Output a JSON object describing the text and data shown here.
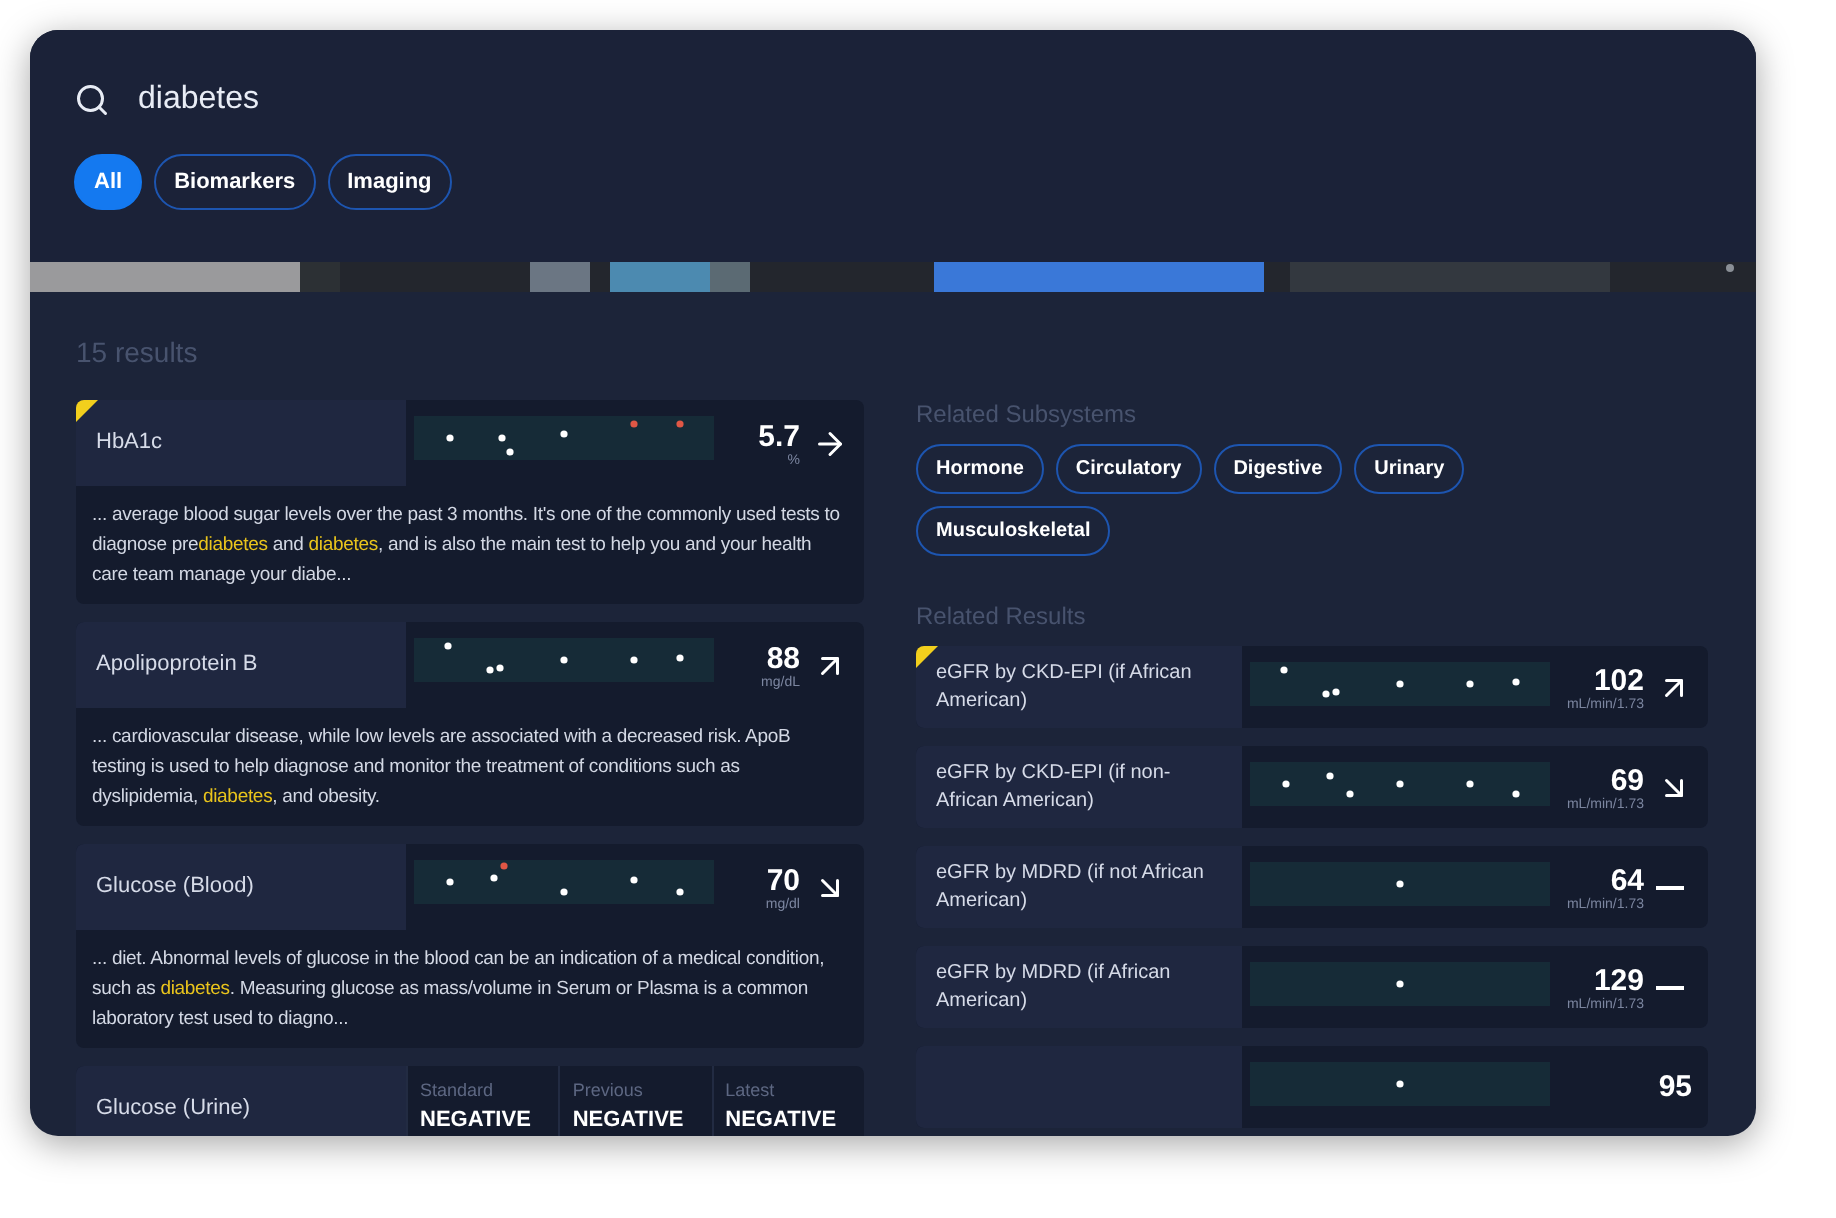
{
  "search": {
    "value": "diabetes"
  },
  "filters": [
    {
      "label": "All",
      "selected": true
    },
    {
      "label": "Biomarkers",
      "selected": false
    },
    {
      "label": "Imaging",
      "selected": false
    }
  ],
  "results_count": "15 results",
  "results": [
    {
      "kind": "numeric",
      "name": "HbA1c",
      "flagged": true,
      "value": "5.7",
      "unit": "%",
      "trend": {
        "kind": "right"
      },
      "snippet": "... average blood sugar levels over the past 3 months. It's one of the commonly used tests to diagnose pre**diabetes** and **diabetes**, and is also the main test to help you and your health care team manage your diabe..."
    },
    {
      "kind": "numeric",
      "name": "Apolipoprotein B",
      "flagged": false,
      "value": "88",
      "unit": "mg/dL",
      "trend": {
        "kind": "up"
      },
      "snippet": "... cardiovascular disease, while low levels are associated with a decreased risk. ApoB testing is used to help diagnose and monitor the treatment of conditions such as dyslipidemia, **diabetes**, and obesity."
    },
    {
      "kind": "numeric",
      "name": "Glucose (Blood)",
      "flagged": false,
      "value": "70",
      "unit": "mg/dl",
      "trend": {
        "kind": "down"
      },
      "snippet": "... diet. Abnormal levels of glucose in the blood can be an indication of a medical condition, such as **diabetes**. Measuring glucose as mass/volume in Serum or Plasma is a common laboratory test used to diagno..."
    },
    {
      "kind": "categorical",
      "name": "Glucose (Urine)",
      "flagged": false,
      "columns": [
        {
          "label": "Standard",
          "value": "NEGATIVE"
        },
        {
          "label": "Previous",
          "value": "NEGATIVE"
        },
        {
          "label": "Latest",
          "value": "NEGATIVE"
        }
      ]
    }
  ],
  "related_subsystems": {
    "title": "Related Subsystems",
    "chips": [
      "Hormone",
      "Circulatory",
      "Digestive",
      "Urinary",
      "Musculoskeletal"
    ]
  },
  "related_results": {
    "title": "Related Results",
    "items": [
      {
        "name": "eGFR by CKD-EPI (if African American)",
        "flagged": true,
        "value": "102",
        "unit": "mL/min/1.73",
        "trend": {
          "kind": "up"
        }
      },
      {
        "name": "eGFR by CKD-EPI (if non-African American)",
        "flagged": false,
        "value": "69",
        "unit": "mL/min/1.73",
        "trend": {
          "kind": "down"
        }
      },
      {
        "name": "eGFR by MDRD (if not African American)",
        "flagged": false,
        "value": "64",
        "unit": "mL/min/1.73",
        "trend": {
          "kind": "flat"
        }
      },
      {
        "name": "eGFR by MDRD (if African American)",
        "flagged": false,
        "value": "129",
        "unit": "mL/min/1.73",
        "trend": {
          "kind": "flat"
        }
      },
      {
        "flagged": false,
        "value": "95"
      }
    ]
  }
}
